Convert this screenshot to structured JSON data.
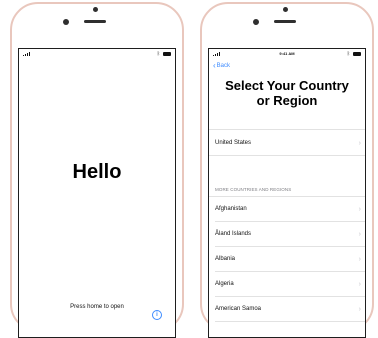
{
  "left_screen": {
    "greeting": "Hello",
    "prompt": "Press home to open"
  },
  "right_screen": {
    "status_time": "9:41 AM",
    "back_label": "Back",
    "title_line1": "Select Your Country",
    "title_line2": "or Region",
    "featured": "United States",
    "section_header": "MORE COUNTRIES AND REGIONS",
    "countries": [
      "Afghanistan",
      "Åland Islands",
      "Albania",
      "Algeria",
      "American Samoa"
    ]
  },
  "colors": {
    "accent": "#3d8bff",
    "frame": "#e9c7bd"
  }
}
